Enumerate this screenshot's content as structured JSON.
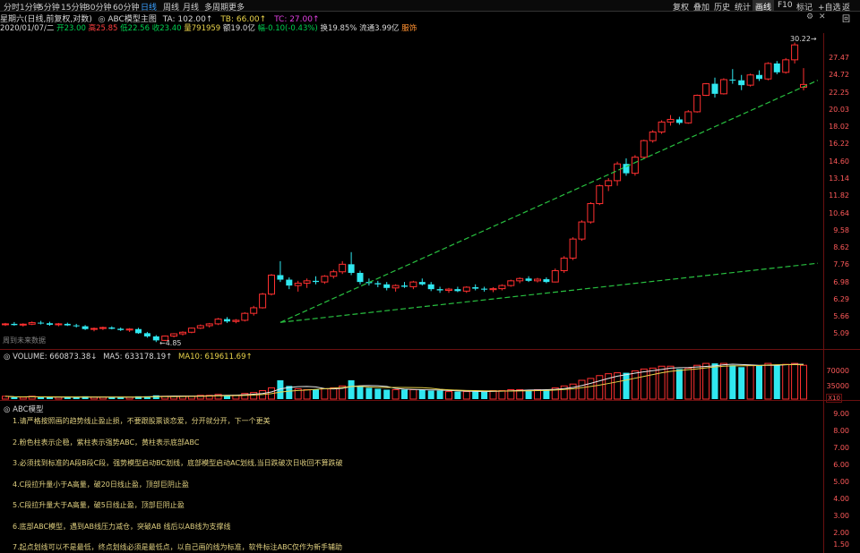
{
  "toolbar": {
    "periods": [
      "分时",
      "1分钟",
      "5分钟",
      "15分钟",
      "30分钟",
      "60分钟",
      "日线",
      "周线",
      "月线",
      "多周期",
      "更多"
    ],
    "active_period": "日线",
    "right_buttons": [
      "复权",
      "叠加",
      "历史",
      "统计",
      "画线",
      "F10",
      "标记",
      "+自选",
      "返回"
    ],
    "active_right": "画线"
  },
  "title": {
    "stock": "星期六(日线,前复权,对数)",
    "indicator": "ABC模型主图",
    "ta": "TA: 102.00↑",
    "tb": "TB: 66.00↑",
    "tc": "TC: 27.00↑"
  },
  "ohlc": {
    "date": "2020/01/07/二",
    "open": "开23.00",
    "high": "高25.85",
    "low": "低22.56",
    "close": "收23.40",
    "volume": "量791959",
    "amount": "额19.0亿",
    "change": "幅-0.10(-0.43%)",
    "turnover": "换19.85%",
    "float": "流通3.99亿",
    "sector": "服饰"
  },
  "price_axis": [
    "30.22",
    "27.47",
    "24.72",
    "22.25",
    "20.03",
    "18.02",
    "16.22",
    "14.60",
    "13.14",
    "11.82",
    "10.64",
    "9.58",
    "8.62",
    "7.76",
    "6.98",
    "6.29",
    "5.66",
    "5.09"
  ],
  "price_markers": {
    "high": "30.22",
    "low": "4.85"
  },
  "future_note": "周到未来数据",
  "volume_header": {
    "volume": "VOLUME: 660873.38↓",
    "ma5": "MA5: 633178.19↑",
    "ma10": "MA10: 619611.69↑"
  },
  "volume_axis": [
    "70000",
    "35000"
  ],
  "volume_unit": "X10",
  "abc_panel": {
    "title": "ABC模型",
    "axis": [
      "9.00",
      "8.00",
      "7.00",
      "6.00",
      "5.00",
      "4.00",
      "3.00",
      "2.00",
      "1.50"
    ],
    "notes": [
      "1.请严格按照画的趋势线止盈止损，不要跟股票谈恋爱，分开就分开，下一个更美",
      "2.粉色柱表示企稳，紫柱表示强势ABC，黄柱表示底部ABC",
      "3.必须找到标准的A段B段C段，强势模型启动BC划线，底部模型启动AC划线,当日跌破次日收回不算跌破",
      "4.C段拉升量小于A高量，破20日线止盈，顶部巨阴止盈",
      "5.C段拉升量大于A高量，破5日线止盈，顶部巨阴止盈",
      "6.底部ABC模型，遇到AB线压力减仓，突破AB 线后以AB线为支撑线",
      "7.起点划线可以不是最低，终点划线必须是最低点，以自己画的线为标准，软件标注ABC仅作为新手辅助"
    ]
  },
  "colors": {
    "up": "#ff3030",
    "down": "#30e8f0",
    "trend": "#28c040",
    "ma5": "#e8e8e8",
    "ma10": "#e8d24a",
    "axis": "#ff5a5a",
    "border": "#6a1010"
  },
  "chart_data": {
    "type": "candlestick",
    "scale": "log",
    "ylim": [
      4.7,
      31.5
    ],
    "candles": [
      [
        5.4,
        5.45,
        5.35,
        5.42
      ],
      [
        5.42,
        5.48,
        5.36,
        5.38
      ],
      [
        5.38,
        5.44,
        5.33,
        5.41
      ],
      [
        5.41,
        5.5,
        5.38,
        5.46
      ],
      [
        5.46,
        5.52,
        5.4,
        5.44
      ],
      [
        5.44,
        5.49,
        5.36,
        5.39
      ],
      [
        5.39,
        5.45,
        5.34,
        5.42
      ],
      [
        5.42,
        5.46,
        5.35,
        5.37
      ],
      [
        5.37,
        5.42,
        5.3,
        5.34
      ],
      [
        5.34,
        5.38,
        5.22,
        5.25
      ],
      [
        5.25,
        5.3,
        5.18,
        5.27
      ],
      [
        5.27,
        5.33,
        5.22,
        5.3
      ],
      [
        5.3,
        5.34,
        5.24,
        5.26
      ],
      [
        5.26,
        5.3,
        5.19,
        5.22
      ],
      [
        5.22,
        5.28,
        5.16,
        5.25
      ],
      [
        5.25,
        5.29,
        5.1,
        5.12
      ],
      [
        5.12,
        5.16,
        4.98,
        5.02
      ],
      [
        5.02,
        5.06,
        4.85,
        4.9
      ],
      [
        4.9,
        5.05,
        4.88,
        5.03
      ],
      [
        5.03,
        5.12,
        4.99,
        5.1
      ],
      [
        5.1,
        5.18,
        5.05,
        5.15
      ],
      [
        5.15,
        5.3,
        5.12,
        5.28
      ],
      [
        5.28,
        5.4,
        5.25,
        5.36
      ],
      [
        5.36,
        5.45,
        5.3,
        5.42
      ],
      [
        5.42,
        5.62,
        5.38,
        5.58
      ],
      [
        5.58,
        5.65,
        5.45,
        5.5
      ],
      [
        5.5,
        5.58,
        5.44,
        5.54
      ],
      [
        5.54,
        5.82,
        5.5,
        5.78
      ],
      [
        5.78,
        6.05,
        5.7,
        5.98
      ],
      [
        5.98,
        6.55,
        5.95,
        6.5
      ],
      [
        6.5,
        7.35,
        6.45,
        7.3
      ],
      [
        7.3,
        7.95,
        7.0,
        7.1
      ],
      [
        7.1,
        7.2,
        6.7,
        6.85
      ],
      [
        6.85,
        7.05,
        6.6,
        6.95
      ],
      [
        6.95,
        7.15,
        6.75,
        7.05
      ],
      [
        7.05,
        7.25,
        6.9,
        7.0
      ],
      [
        7.0,
        7.3,
        6.92,
        7.25
      ],
      [
        7.25,
        7.55,
        7.15,
        7.45
      ],
      [
        7.45,
        7.95,
        7.35,
        7.8
      ],
      [
        7.8,
        8.4,
        7.3,
        7.4
      ],
      [
        7.4,
        7.5,
        6.9,
        7.0
      ],
      [
        7.0,
        7.15,
        6.85,
        6.95
      ],
      [
        6.95,
        7.05,
        6.78,
        6.9
      ],
      [
        6.9,
        7.0,
        6.65,
        6.75
      ],
      [
        6.75,
        6.9,
        6.6,
        6.85
      ],
      [
        6.85,
        7.0,
        6.75,
        6.8
      ],
      [
        6.8,
        7.05,
        6.7,
        7.0
      ],
      [
        7.0,
        7.15,
        6.85,
        6.9
      ],
      [
        6.9,
        7.0,
        6.62,
        6.7
      ],
      [
        6.7,
        6.8,
        6.55,
        6.65
      ],
      [
        6.65,
        6.75,
        6.55,
        6.7
      ],
      [
        6.7,
        6.8,
        6.58,
        6.62
      ],
      [
        6.62,
        6.82,
        6.55,
        6.78
      ],
      [
        6.78,
        6.9,
        6.65,
        6.72
      ],
      [
        6.72,
        6.8,
        6.6,
        6.68
      ],
      [
        6.68,
        6.78,
        6.58,
        6.72
      ],
      [
        6.72,
        6.9,
        6.65,
        6.85
      ],
      [
        6.85,
        7.1,
        6.8,
        7.05
      ],
      [
        7.05,
        7.2,
        6.95,
        7.15
      ],
      [
        7.15,
        7.25,
        7.0,
        7.05
      ],
      [
        7.05,
        7.18,
        6.98,
        7.12
      ],
      [
        7.12,
        7.2,
        6.95,
        7.0
      ],
      [
        7.0,
        7.6,
        6.98,
        7.5
      ],
      [
        7.5,
        8.2,
        7.4,
        8.1
      ],
      [
        8.1,
        9.2,
        8.0,
        9.1
      ],
      [
        9.1,
        10.2,
        9.0,
        10.1
      ],
      [
        10.1,
        11.4,
        10.0,
        11.3
      ],
      [
        11.3,
        12.7,
        11.2,
        12.6
      ],
      [
        12.6,
        13.2,
        12.2,
        13.0
      ],
      [
        13.0,
        14.6,
        12.6,
        14.4
      ],
      [
        14.4,
        14.9,
        13.4,
        13.6
      ],
      [
        13.6,
        15.2,
        13.4,
        15.0
      ],
      [
        15.0,
        16.7,
        14.9,
        16.6
      ],
      [
        16.6,
        17.7,
        16.4,
        17.5
      ],
      [
        17.5,
        18.8,
        17.3,
        18.6
      ],
      [
        18.6,
        19.4,
        18.2,
        18.9
      ],
      [
        18.9,
        19.2,
        18.3,
        18.5
      ],
      [
        18.5,
        20.0,
        18.4,
        19.8
      ],
      [
        19.8,
        22.0,
        19.7,
        21.9
      ],
      [
        21.9,
        23.6,
        21.8,
        23.5
      ],
      [
        23.5,
        24.4,
        21.6,
        22.1
      ],
      [
        22.1,
        24.3,
        22.0,
        24.1
      ],
      [
        24.1,
        25.7,
        23.5,
        24.0
      ],
      [
        24.0,
        24.8,
        22.6,
        23.3
      ],
      [
        23.3,
        25.0,
        23.1,
        24.8
      ],
      [
        24.8,
        25.5,
        23.9,
        24.2
      ],
      [
        24.2,
        26.8,
        24.0,
        26.6
      ],
      [
        26.6,
        27.0,
        24.9,
        25.2
      ],
      [
        25.2,
        27.5,
        25.0,
        27.2
      ],
      [
        27.2,
        30.22,
        26.6,
        29.8
      ],
      [
        23.0,
        25.85,
        22.56,
        23.4
      ]
    ],
    "volumes": [
      3,
      2,
      2,
      3,
      2,
      2,
      2,
      2,
      2,
      3,
      2,
      2,
      2,
      2,
      2,
      3,
      3,
      4,
      3,
      3,
      3,
      3,
      4,
      4,
      5,
      4,
      4,
      6,
      7,
      9,
      12,
      20,
      14,
      11,
      10,
      10,
      11,
      12,
      14,
      20,
      14,
      12,
      11,
      10,
      10,
      10,
      10,
      10,
      9,
      9,
      8,
      8,
      8,
      8,
      8,
      9,
      9,
      10,
      10,
      10,
      10,
      10,
      12,
      14,
      16,
      20,
      22,
      25,
      27,
      28,
      28,
      30,
      32,
      33,
      35,
      35,
      32,
      33,
      36,
      38,
      38,
      38,
      36,
      34,
      36,
      36,
      38,
      36,
      37,
      38,
      36
    ],
    "volume_max": 40,
    "trend_lines": [
      {
        "from": [
          31,
          5.47
        ],
        "to": [
          91,
          24.0
        ]
      },
      {
        "from": [
          31,
          5.47
        ],
        "to": [
          91,
          7.85
        ]
      }
    ]
  }
}
